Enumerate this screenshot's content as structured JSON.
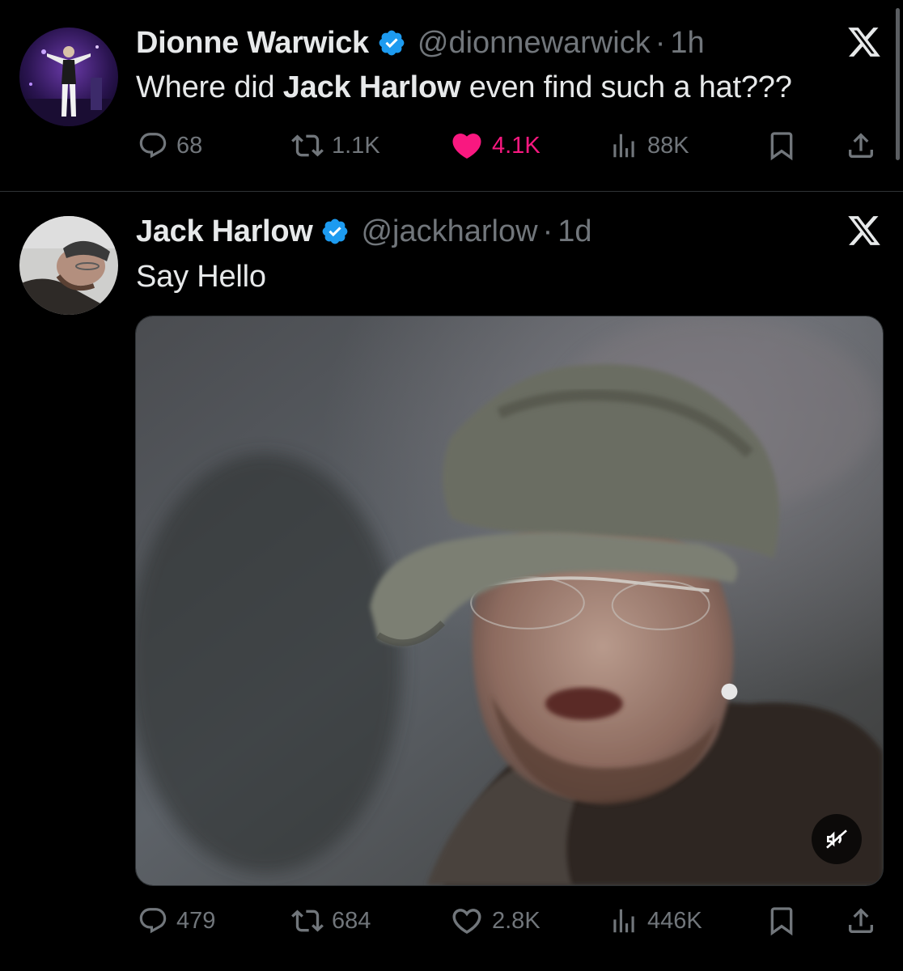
{
  "tweets": [
    {
      "display_name": "Dionne Warwick",
      "handle": "@dionnewarwick",
      "separator": "·",
      "time": "1h",
      "text_parts": [
        "Where did ",
        "Jack Harlow",
        " even find such a hat???"
      ],
      "stats": {
        "replies": "68",
        "reposts": "1.1K",
        "likes": "4.1K",
        "views": "88K"
      },
      "liked": true,
      "avatar_icon": "stage-performer-avatar"
    },
    {
      "display_name": "Jack Harlow",
      "handle": "@jackharlow",
      "separator": "·",
      "time": "1d",
      "text": "Say Hello",
      "stats": {
        "replies": "479",
        "reposts": "684",
        "likes": "2.8K",
        "views": "446K"
      },
      "liked": false,
      "avatar_icon": "profile-photo-avatar",
      "media": {
        "type": "video",
        "muted": true,
        "mute_icon": "speaker-muted-icon"
      }
    }
  ],
  "colors": {
    "background": "#000000",
    "primary_text": "#e7e9ea",
    "secondary_text": "#71767b",
    "verified_blue": "#1d9bf0",
    "like_pink": "#f91880",
    "divider": "#2f3336"
  },
  "icons": {
    "brand": "x-logo-icon",
    "verified": "verified-badge-icon",
    "reply": "reply-icon",
    "repost": "repost-icon",
    "like": "heart-icon",
    "views": "views-icon",
    "bookmark": "bookmark-icon",
    "share": "share-icon"
  }
}
